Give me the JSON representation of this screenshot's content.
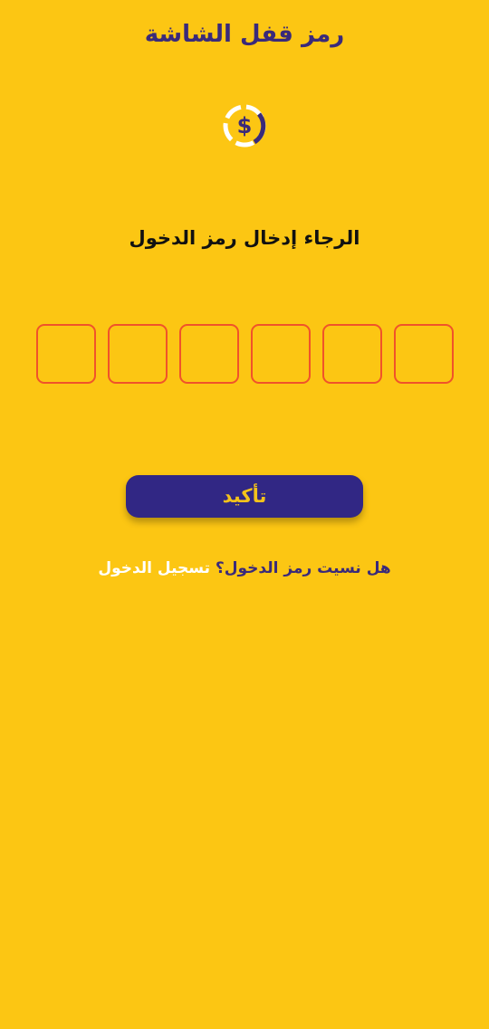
{
  "header": {
    "title": "رمز قفل الشاشة"
  },
  "logo": {
    "icon": "dollar-coin-icon",
    "colors": {
      "ring_light": "#FFFFFF",
      "ring_dark": "#3A2A7A",
      "symbol": "#3A2A7A"
    }
  },
  "prompt": {
    "text": "الرجاء إدخال رمز الدخول"
  },
  "pin": {
    "length": 6,
    "digits": [
      "",
      "",
      "",
      "",
      "",
      ""
    ]
  },
  "actions": {
    "confirm_label": "تأكيد",
    "forgot_text": "هل نسيت رمز الدخول؟",
    "signin_link": "تسجيل الدخول"
  },
  "colors": {
    "background": "#FCC613",
    "primary": "#312784",
    "accent_border": "#F0532A",
    "button_text": "#F4C21B"
  }
}
